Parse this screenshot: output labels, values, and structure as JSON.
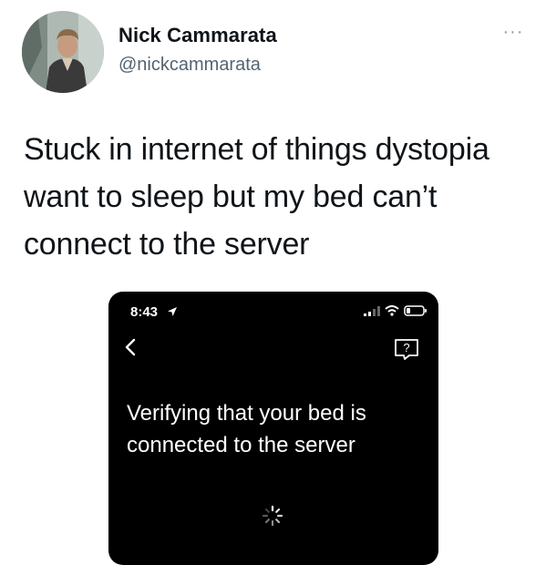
{
  "author": {
    "name": "Nick Cammarata",
    "handle": "@nickcammarata"
  },
  "tweet": {
    "text": "Stuck in internet of things dystopia\nwant to sleep but my bed can’t\nconnect to the server"
  },
  "more_menu": {
    "icon": "more-icon",
    "label": "···"
  },
  "screenshot": {
    "status_bar": {
      "time": "8:43",
      "icons": [
        "location-icon",
        "cellular-signal-icon",
        "wifi-icon",
        "battery-icon"
      ]
    },
    "nav": {
      "back_icon": "chevron-left-icon",
      "help_icon": "help-icon",
      "help_label": "?"
    },
    "message": "Verifying that your bed is\nconnected to the server",
    "loading_icon": "spinner-icon"
  },
  "colors": {
    "text_primary": "#0f1419",
    "text_secondary": "#536471",
    "screen_background": "#000000",
    "screen_text": "#ffffff"
  }
}
